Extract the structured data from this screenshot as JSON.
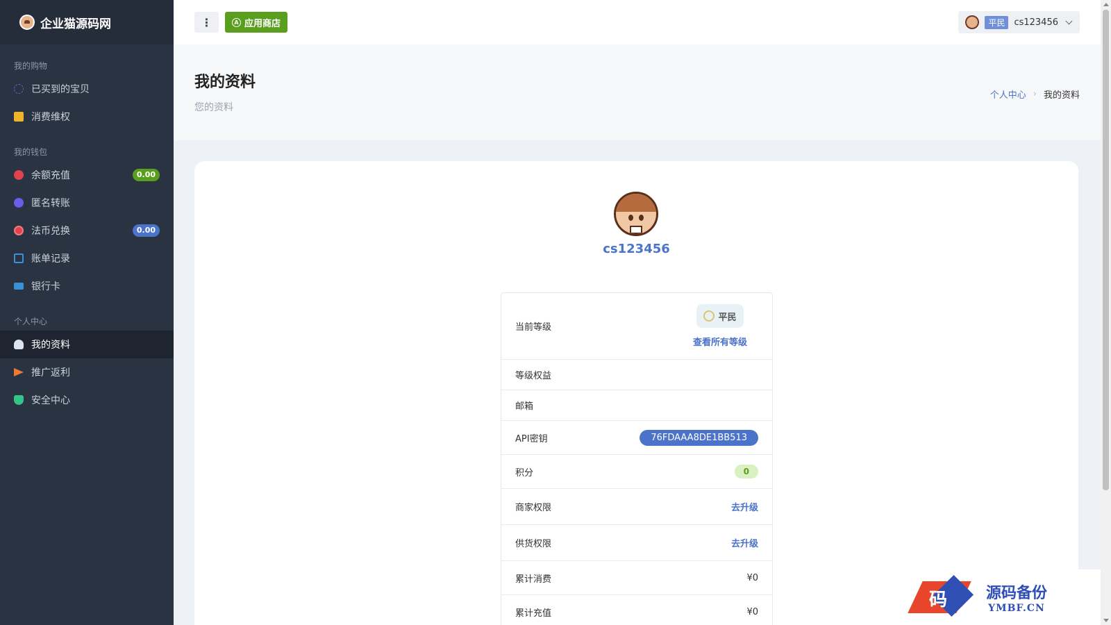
{
  "brand": {
    "name": "企业猫源码网"
  },
  "sidebar": {
    "sections": [
      {
        "title": "我的购物",
        "items": [
          {
            "label": "已买到的宝贝",
            "icon": "circle-dash-icon"
          },
          {
            "label": "消费维权",
            "icon": "note-icon"
          }
        ]
      },
      {
        "title": "我的钱包",
        "items": [
          {
            "label": "余额充值",
            "icon": "recharge-icon",
            "badge": "0.00"
          },
          {
            "label": "匿名转账",
            "icon": "transfer-icon"
          },
          {
            "label": "法币兑换",
            "icon": "exchange-icon",
            "badge": "0.00"
          },
          {
            "label": "账单记录",
            "icon": "bill-icon"
          },
          {
            "label": "银行卡",
            "icon": "bank-card-icon"
          }
        ]
      },
      {
        "title": "个人中心",
        "items": [
          {
            "label": "我的资料",
            "icon": "user-icon",
            "active": true
          },
          {
            "label": "推广返利",
            "icon": "paper-plane-icon"
          },
          {
            "label": "安全中心",
            "icon": "shield-icon"
          }
        ]
      }
    ]
  },
  "topbar": {
    "store_label": "应用商店",
    "user_rank": "平民",
    "username": "cs123456"
  },
  "header": {
    "title": "我的资料",
    "subtitle": "您的资料",
    "breadcrumb": {
      "parent": "个人中心",
      "current": "我的资料"
    }
  },
  "profile": {
    "username": "cs123456",
    "rows": {
      "level_label": "当前等级",
      "level_value": "平民",
      "level_link": "查看所有等级",
      "benefits_label": "等级权益",
      "email_label": "邮箱",
      "api_label": "API密钥",
      "api_value": "76FDAAA8DE1BB513",
      "points_label": "积分",
      "points_value": "0",
      "merchant_label": "商家权限",
      "merchant_link": "去升级",
      "supply_label": "供货权限",
      "supply_link": "去升级",
      "total_spent_label": "累计消费",
      "total_spent_value": "¥0",
      "total_recharge_label": "累计充值",
      "total_recharge_value": "¥0"
    }
  },
  "watermark": {
    "char": "码",
    "title": "源码备份",
    "site": "YMBF.CN"
  }
}
